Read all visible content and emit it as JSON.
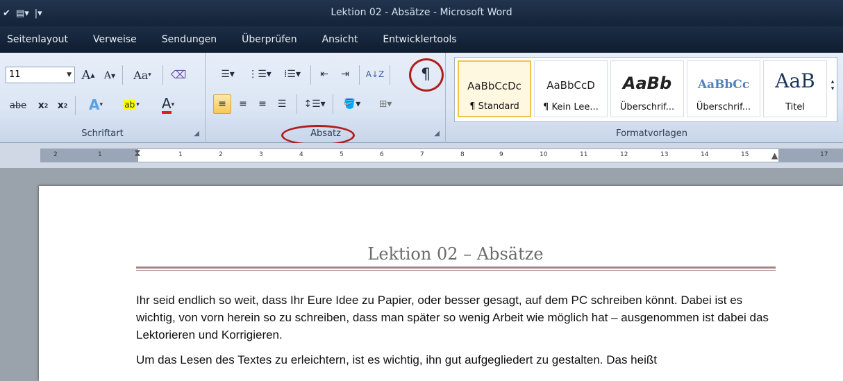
{
  "window": {
    "title": "Lektion 02 - Absätze - Microsoft Word"
  },
  "tabs": [
    "Seitenlayout",
    "Verweise",
    "Sendungen",
    "Überprüfen",
    "Ansicht",
    "Entwicklertools"
  ],
  "font_group": {
    "label": "Schriftart",
    "font_size": "11",
    "grow_font": "A",
    "shrink_font": "A",
    "change_case": "Aa",
    "strikethrough": "abe",
    "subscript": "x",
    "superscript": "x",
    "text_effects": "A",
    "highlight": "ab",
    "font_color": "A"
  },
  "paragraph_group": {
    "label": "Absatz",
    "show_marks": "¶"
  },
  "styles_group": {
    "label": "Formatvorlagen",
    "items": [
      {
        "sample": "AaBbCcDc",
        "name": "¶ Standard"
      },
      {
        "sample": "AaBbCcD",
        "name": "¶ Kein Lee..."
      },
      {
        "sample": "AaBb",
        "name": "Überschrif..."
      },
      {
        "sample": "AaBbCc",
        "name": "Überschrif..."
      },
      {
        "sample": "AaB",
        "name": "Titel"
      }
    ]
  },
  "ruler": {
    "ticks": [
      "2",
      "1",
      "1",
      "2",
      "3",
      "4",
      "5",
      "6",
      "7",
      "8",
      "9",
      "10",
      "11",
      "12",
      "13",
      "14",
      "15",
      "17"
    ]
  },
  "document": {
    "title": "Lektion 02 – Absätze",
    "paragraphs": [
      "Ihr seid endlich so weit, dass Ihr Eure Idee zu Papier, oder besser gesagt, auf dem PC schreiben könnt. Dabei ist es wichtig, von vorn herein so zu schreiben, dass man später so wenig Arbeit wie möglich hat – ausgenommen ist dabei das Lektorieren und Korrigieren.",
      "Um das Lesen des Textes zu erleichtern, ist es wichtig, ihn gut aufgegliedert zu gestalten. Das heißt"
    ]
  },
  "colors": {
    "annotation_ring": "#b11d1d",
    "title_rule": "#a58485",
    "selected_style": "#f2c14e"
  }
}
